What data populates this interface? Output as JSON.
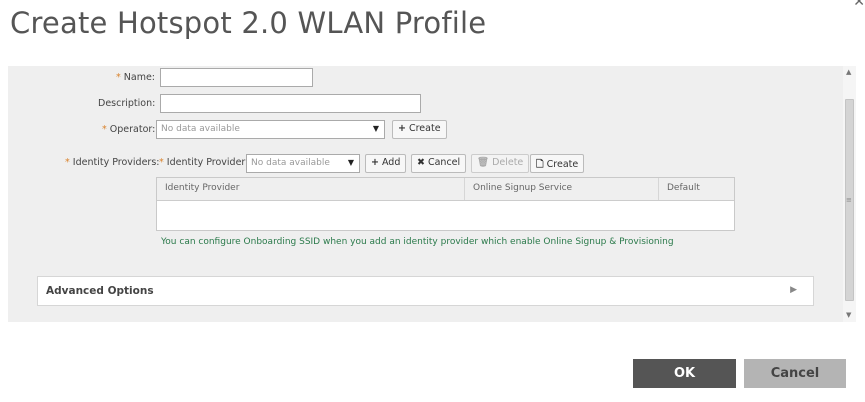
{
  "dialog": {
    "title": "Create Hotspot 2.0 WLAN Profile"
  },
  "form": {
    "name_label": "Name:",
    "name_value": "",
    "description_label": "Description:",
    "description_value": "",
    "operator_label": "Operator:",
    "operator_select": "No data available",
    "operator_create": "Create",
    "identity_providers_label": "Identity Providers:",
    "identity_provider_sub_label": "Identity Provider",
    "identity_provider_select": "No data available",
    "add_label": "Add",
    "cancel_label": "Cancel",
    "delete_label": "Delete",
    "create_label": "Create"
  },
  "table": {
    "columns": [
      "Identity Provider",
      "Online Signup Service",
      "Default"
    ],
    "rows": []
  },
  "hint": "You can configure Onboarding SSID when you add an identity provider which enable Online Signup & Provisioning",
  "advanced": {
    "label": "Advanced Options"
  },
  "footer": {
    "ok_label": "OK",
    "cancel_label": "Cancel"
  },
  "colors": {
    "required": "#d9822b",
    "hint": "#2b7a4b",
    "ok_bg": "#555555",
    "cancel_bg": "#b4b4b4"
  },
  "icons": [
    "close-icon",
    "plus-icon",
    "x-icon",
    "trash-icon",
    "document-icon",
    "triangle-right-icon",
    "caret-down-icon"
  ]
}
